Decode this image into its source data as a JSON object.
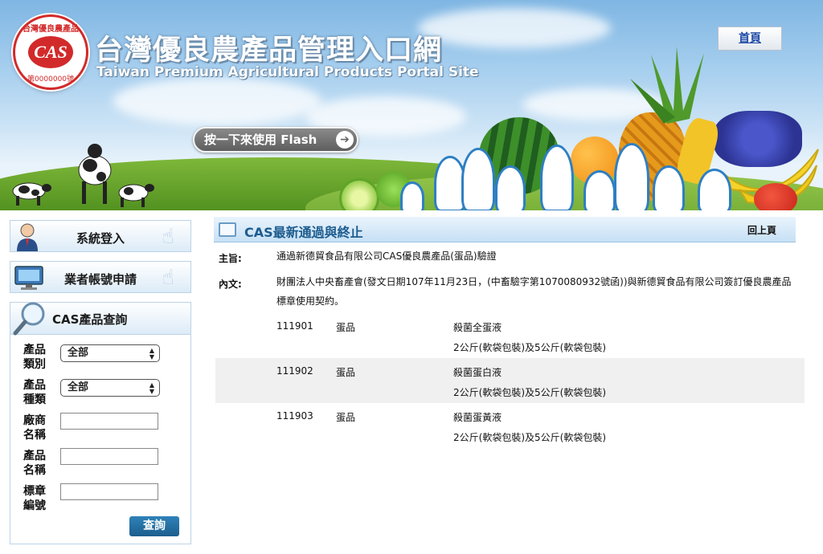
{
  "header": {
    "logo_ring_text": "台灣優良農產品",
    "logo_mark": "CAS",
    "logo_number": "第0000000號",
    "title": "台灣優良農產品管理入口網",
    "subtitle": "Taiwan Premium Agricultural Products Portal Site",
    "flash_button": "按一下來使用 Flash",
    "home_link": "首頁"
  },
  "sidebar": {
    "login_label": "系統登入",
    "apply_label": "業者帳號申請",
    "search": {
      "title": "CAS產品查詢",
      "fields": [
        {
          "label": "產品類別",
          "type": "select",
          "value": "全部"
        },
        {
          "label": "產品種類",
          "type": "select",
          "value": "全部"
        },
        {
          "label": "廠商名稱",
          "type": "text",
          "value": ""
        },
        {
          "label": "產品名稱",
          "type": "text",
          "value": ""
        },
        {
          "label": "標章編號",
          "type": "text",
          "value": ""
        }
      ],
      "submit_label": "查詢"
    }
  },
  "content": {
    "title": "CAS最新通過與終止",
    "back_label": "回上頁",
    "subject_label": "主旨:",
    "subject_text": "通過新德貿食品有限公司CAS優良農產品(蛋品)驗證",
    "body_label": "內文:",
    "body_line1": "財團法人中央畜產會(發文日期107年11月23日，(中畜驗字第1070080932號函))與新德貿食品有限公司簽訂優良農產品",
    "body_line2": "標章使用契約。",
    "products": [
      {
        "code": "111901",
        "category": "蛋品",
        "name": "殺菌全蛋液",
        "spec": "2公斤(軟袋包裝)及5公斤(軟袋包裝)"
      },
      {
        "code": "111902",
        "category": "蛋品",
        "name": "殺菌蛋白液",
        "spec": "2公斤(軟袋包裝)及5公斤(軟袋包裝)"
      },
      {
        "code": "111903",
        "category": "蛋品",
        "name": "殺菌蛋黃液",
        "spec": "2公斤(軟袋包裝)及5公斤(軟袋包裝)"
      }
    ]
  },
  "colors": {
    "accent_blue": "#1d5c8e",
    "link_blue": "#1c49a6",
    "button_blue": "#1b5e8e",
    "logo_red": "#d22a2a"
  }
}
